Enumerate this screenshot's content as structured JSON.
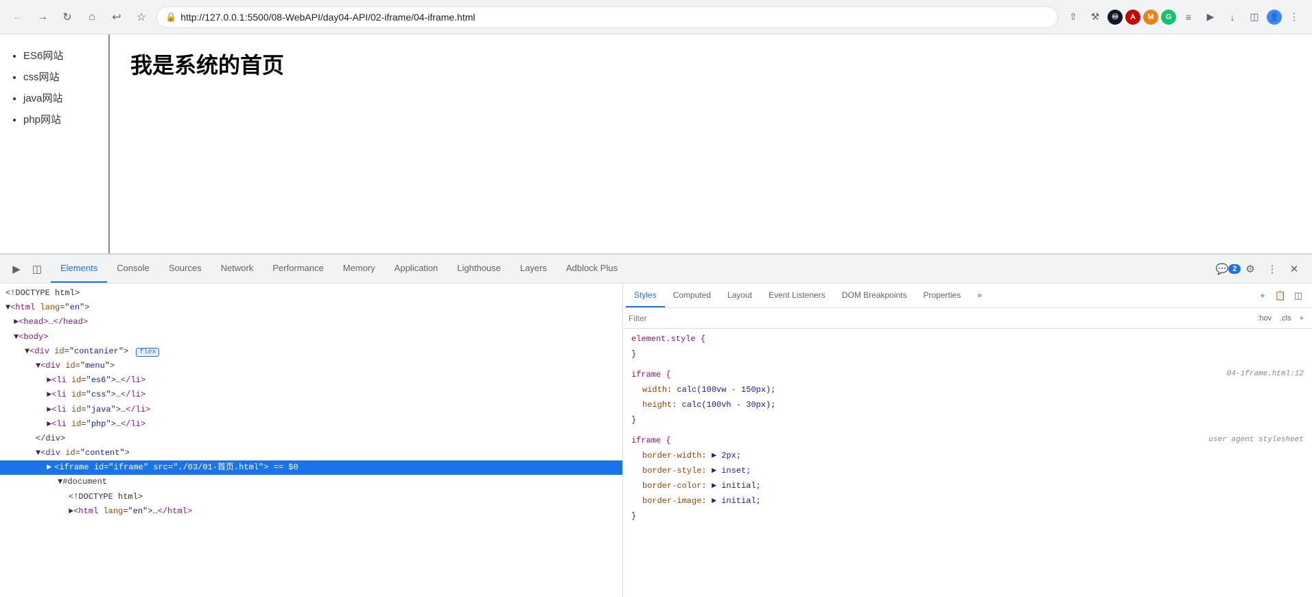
{
  "browser": {
    "url": "http://127.0.0.1:5500/08-WebAPI/day04-API/02-iframe/04-iframe.html",
    "nav": {
      "back": "←",
      "forward": "→",
      "reload": "↺",
      "home": "⌂",
      "history_back": "↩",
      "star": "☆"
    },
    "extensions": [
      {
        "id": "infinity",
        "color": "#1a1a2e",
        "text": "∞"
      },
      {
        "id": "adblock",
        "color": "#c00",
        "text": "A"
      },
      {
        "id": "metamask",
        "color": "#e8831a",
        "text": "M"
      },
      {
        "id": "grammarly",
        "color": "#15c26b",
        "text": "G"
      },
      {
        "id": "grid",
        "color": "#5f6368",
        "text": "⊞"
      },
      {
        "id": "cast",
        "color": "#5f6368",
        "text": "▶"
      },
      {
        "id": "download",
        "color": "#5f6368",
        "text": "↓"
      },
      {
        "id": "sidebar",
        "color": "#5f6368",
        "text": "◫"
      },
      {
        "id": "avatar",
        "color": "#4285f4",
        "text": "👤"
      }
    ],
    "more": "⋮"
  },
  "page": {
    "sidebar_links": [
      {
        "id": "es6",
        "label": "ES6网站"
      },
      {
        "id": "css",
        "label": "css网站"
      },
      {
        "id": "java",
        "label": "java网站"
      },
      {
        "id": "php",
        "label": "php网站"
      }
    ],
    "main_heading": "我是系统的首页"
  },
  "devtools": {
    "tabs": [
      {
        "id": "elements",
        "label": "Elements",
        "active": true
      },
      {
        "id": "console",
        "label": "Console"
      },
      {
        "id": "sources",
        "label": "Sources"
      },
      {
        "id": "network",
        "label": "Network"
      },
      {
        "id": "performance",
        "label": "Performance"
      },
      {
        "id": "memory",
        "label": "Memory"
      },
      {
        "id": "application",
        "label": "Application"
      },
      {
        "id": "lighthouse",
        "label": "Lighthouse"
      },
      {
        "id": "layers",
        "label": "Layers"
      },
      {
        "id": "adblock",
        "label": "Adblock Plus"
      }
    ],
    "badge_count": "2",
    "html_tree": [
      {
        "indent": "",
        "content": "<!DOCTYPE html>",
        "highlighted": false
      },
      {
        "indent": "indent-0",
        "content": "<html lang=\"en\">",
        "highlighted": false
      },
      {
        "indent": "indent-1",
        "content": "<head>…</head>",
        "highlighted": false
      },
      {
        "indent": "indent-1",
        "content": "<body>",
        "highlighted": false
      },
      {
        "indent": "indent-2",
        "content": "<div id=\"contanier\">",
        "highlighted": false,
        "badge": "flex"
      },
      {
        "indent": "indent-3",
        "content": "<div id=\"menu\">",
        "highlighted": false
      },
      {
        "indent": "indent-4",
        "content": "<li id=\"es6\">…</li>",
        "highlighted": false
      },
      {
        "indent": "indent-4",
        "content": "<li id=\"css\">…</li>",
        "highlighted": false
      },
      {
        "indent": "indent-4",
        "content": "<li id=\"java\">…</li>",
        "highlighted": false
      },
      {
        "indent": "indent-4",
        "content": "<li id=\"php\">…</li>",
        "highlighted": false
      },
      {
        "indent": "indent-3",
        "content": "</div>",
        "highlighted": false
      },
      {
        "indent": "indent-3",
        "content": "<div id=\"content\">",
        "highlighted": false
      },
      {
        "indent": "indent-4",
        "content": "<iframe id=\"iframe\" src=\"./03/01-首页.html\"> == $0",
        "highlighted": true
      },
      {
        "indent": "indent-5",
        "content": "#document",
        "highlighted": false
      },
      {
        "indent": "indent-6",
        "content": "<!DOCTYPE html>",
        "highlighted": false
      },
      {
        "indent": "indent-6",
        "content": "<html lang=\"en\">…</html>",
        "highlighted": false
      }
    ],
    "styles": {
      "tabs": [
        {
          "id": "styles",
          "label": "Styles",
          "active": true
        },
        {
          "id": "computed",
          "label": "Computed"
        },
        {
          "id": "layout",
          "label": "Layout"
        },
        {
          "id": "event-listeners",
          "label": "Event Listeners"
        },
        {
          "id": "dom-breakpoints",
          "label": "DOM Breakpoints"
        },
        {
          "id": "properties",
          "label": "Properties"
        },
        {
          "id": "more",
          "label": "»"
        }
      ],
      "filter_placeholder": "Filter",
      "filter_actions": [
        ":hov",
        ".cls",
        "+"
      ],
      "rules": [
        {
          "selector": "element.style {",
          "close": "}",
          "source": "",
          "properties": []
        },
        {
          "selector": "iframe {",
          "close": "}",
          "source": "04-iframe.html:12",
          "properties": [
            {
              "name": "width",
              "colon": ":",
              "value": "calc(100vw - 150px);"
            },
            {
              "name": "height",
              "colon": ":",
              "value": "calc(100vh - 30px);"
            }
          ]
        },
        {
          "selector": "iframe {",
          "close": "}",
          "source": "user agent stylesheet",
          "properties": [
            {
              "name": "border-width",
              "colon": ":",
              "value": "▶ 2px;"
            },
            {
              "name": "border-style",
              "colon": ":",
              "value": "▶ inset;"
            },
            {
              "name": "border-color",
              "colon": ":",
              "value": "▶ initial;"
            },
            {
              "name": "border-image",
              "colon": ":",
              "value": "▶ initial;"
            }
          ]
        }
      ]
    }
  }
}
